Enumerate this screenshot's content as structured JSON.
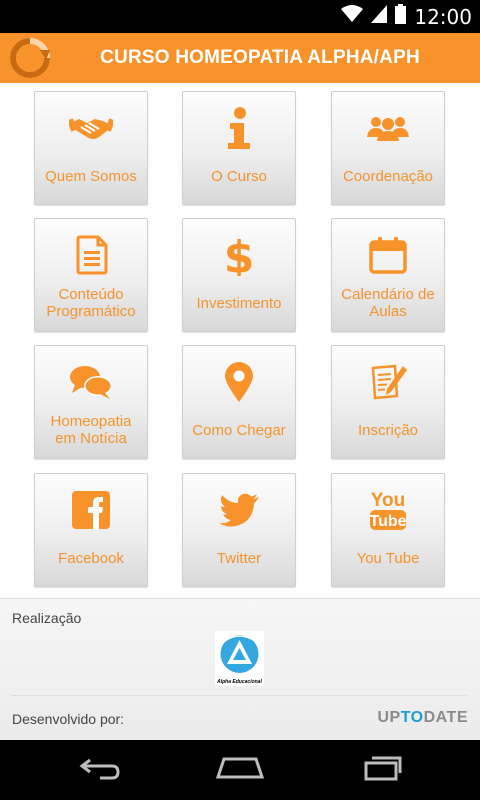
{
  "status_bar": {
    "time": "12:00",
    "icons": [
      "wifi-icon",
      "signal-icon",
      "battery-icon"
    ]
  },
  "app_bar": {
    "title": "CURSO HOMEOPATIA ALPHA/APH",
    "logo_icon": "refresh-arrow-logo-icon",
    "background_color": "#f7932a"
  },
  "menu": {
    "accent_color": "#f7932a",
    "tiles": [
      {
        "label": "Quem Somos",
        "icon": "handshake-icon"
      },
      {
        "label": "O Curso",
        "icon": "info-icon"
      },
      {
        "label": "Coordenação",
        "icon": "people-group-icon"
      },
      {
        "label": "Conteúdo Programático",
        "icon": "document-icon"
      },
      {
        "label": "Investimento",
        "icon": "dollar-icon"
      },
      {
        "label": "Calendário de Aulas",
        "icon": "calendar-icon"
      },
      {
        "label": "Homeopatia em Notícia",
        "icon": "chat-bubbles-icon"
      },
      {
        "label": "Como Chegar",
        "icon": "map-pin-icon"
      },
      {
        "label": "Inscrição",
        "icon": "form-pencil-icon"
      },
      {
        "label": "Facebook",
        "icon": "facebook-icon"
      },
      {
        "label": "Twitter",
        "icon": "twitter-bird-icon"
      },
      {
        "label": "You Tube",
        "icon": "youtube-icon"
      }
    ]
  },
  "footer": {
    "realizacao_label": "Realização",
    "partner_logo_caption": "Alpha Educacional",
    "developed_by_label": "Desenvolvido por:",
    "developer_brand": {
      "part1": "UP",
      "part2": "TO",
      "part3": "DATE"
    },
    "brand_accent_color": "#1a9ed8"
  },
  "nav_bar": {
    "buttons": [
      "back-icon",
      "home-icon",
      "recent-apps-icon"
    ]
  }
}
